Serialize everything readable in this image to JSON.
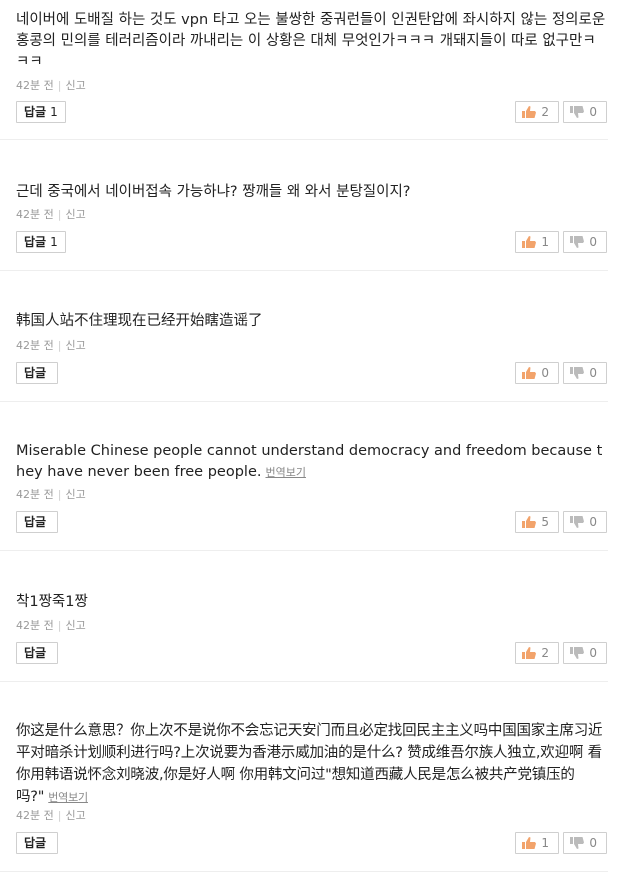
{
  "comments": [
    {
      "text": "네이버에 도배질 하는 것도 vpn 타고 오는 불쌍한 중궈런들이 인권탄압에 좌시하지 않는 정의로운 홍콩의 민의를 테러리즘이라 까내리는 이 상황은 대체 무엇인가ㅋㅋㅋ 개돼지들이 따로 없구만ㅋㅋㅋ",
      "translate": "",
      "time": "42분 전",
      "report": "신고",
      "reply_label": "답글",
      "reply_count": "1",
      "likes": "2",
      "dislikes": "0"
    },
    {
      "text": "근데 중국에서 네이버접속 가능하냐? 짱깨들 왜 와서 분탕질이지?",
      "translate": "",
      "time": "42분 전",
      "report": "신고",
      "reply_label": "답글",
      "reply_count": "1",
      "likes": "1",
      "dislikes": "0"
    },
    {
      "text": "韩国人站不住理现在已经开始瞎造谣了",
      "translate": "",
      "time": "42분 전",
      "report": "신고",
      "reply_label": "답글",
      "reply_count": "",
      "likes": "0",
      "dislikes": "0"
    },
    {
      "text": "Miserable Chinese people cannot understand democracy and freedom because they have never been free people.",
      "translate": "번역보기",
      "time": "42분 전",
      "report": "신고",
      "reply_label": "답글",
      "reply_count": "",
      "likes": "5",
      "dislikes": "0"
    },
    {
      "text": "착1짱죽1짱",
      "translate": "",
      "time": "42분 전",
      "report": "신고",
      "reply_label": "답글",
      "reply_count": "",
      "likes": "2",
      "dislikes": "0"
    },
    {
      "text": "你这是什么意思？你上次不是说你不会忘记天安门而且必定找回民主主义吗中国国家主席习近平对暗杀计划顺利进行吗?上次说要为香港示威加油的是什么? 赞成维吾尔族人独立,欢迎啊 看你用韩语说怀念刘晓波,你是好人啊 你用韩文问过\"想知道西藏人民是怎么被共产党镇压的吗?\"",
      "translate": "번역보기",
      "time": "42분 전",
      "report": "신고",
      "reply_label": "답글",
      "reply_count": "",
      "likes": "1",
      "dislikes": "0"
    }
  ],
  "colors": {
    "text": "#222222",
    "meta": "#999999",
    "like_icon": "#f2a36b",
    "dislike_icon": "#bbbbbb",
    "border": "#cfcfcf"
  },
  "icons": {
    "like": "thumbs-up-icon",
    "dislike": "thumbs-down-icon"
  }
}
